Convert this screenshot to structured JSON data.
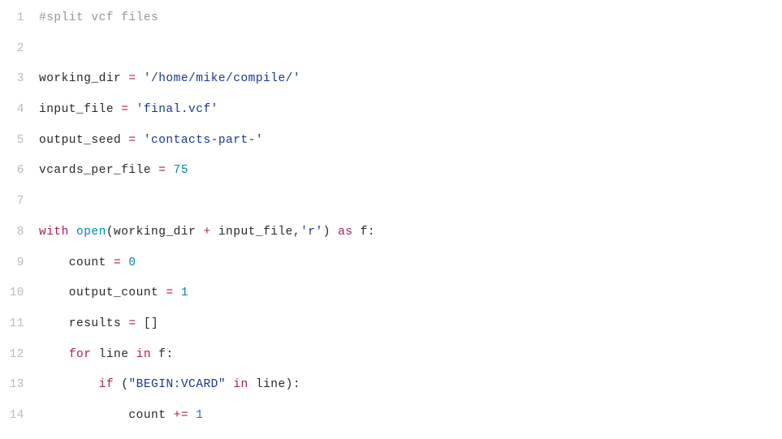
{
  "lines": [
    {
      "n": "1",
      "tokens": [
        {
          "cls": "tok-comment",
          "t": "#split vcf files"
        }
      ]
    },
    {
      "n": "2",
      "tokens": [
        {
          "cls": "tok-default",
          "t": ""
        }
      ]
    },
    {
      "n": "3",
      "tokens": [
        {
          "cls": "tok-default",
          "t": "working_dir "
        },
        {
          "cls": "tok-op",
          "t": "="
        },
        {
          "cls": "tok-default",
          "t": " "
        },
        {
          "cls": "tok-string",
          "t": "'/home/mike/compile/'"
        }
      ]
    },
    {
      "n": "4",
      "tokens": [
        {
          "cls": "tok-default",
          "t": "input_file "
        },
        {
          "cls": "tok-op",
          "t": "="
        },
        {
          "cls": "tok-default",
          "t": " "
        },
        {
          "cls": "tok-string",
          "t": "'final.vcf'"
        }
      ]
    },
    {
      "n": "5",
      "tokens": [
        {
          "cls": "tok-default",
          "t": "output_seed "
        },
        {
          "cls": "tok-op",
          "t": "="
        },
        {
          "cls": "tok-default",
          "t": " "
        },
        {
          "cls": "tok-string",
          "t": "'contacts-part-'"
        }
      ]
    },
    {
      "n": "6",
      "tokens": [
        {
          "cls": "tok-default",
          "t": "vcards_per_file "
        },
        {
          "cls": "tok-op",
          "t": "="
        },
        {
          "cls": "tok-default",
          "t": " "
        },
        {
          "cls": "tok-number",
          "t": "75"
        }
      ]
    },
    {
      "n": "7",
      "tokens": [
        {
          "cls": "tok-default",
          "t": ""
        }
      ]
    },
    {
      "n": "8",
      "tokens": [
        {
          "cls": "tok-keyword",
          "t": "with"
        },
        {
          "cls": "tok-default",
          "t": " "
        },
        {
          "cls": "tok-builtin",
          "t": "open"
        },
        {
          "cls": "tok-default",
          "t": "(working_dir "
        },
        {
          "cls": "tok-op",
          "t": "+"
        },
        {
          "cls": "tok-default",
          "t": " input_file,"
        },
        {
          "cls": "tok-string",
          "t": "'r'"
        },
        {
          "cls": "tok-default",
          "t": ") "
        },
        {
          "cls": "tok-keyword",
          "t": "as"
        },
        {
          "cls": "tok-default",
          "t": " f:"
        }
      ]
    },
    {
      "n": "9",
      "tokens": [
        {
          "cls": "tok-default",
          "t": "    count "
        },
        {
          "cls": "tok-op",
          "t": "="
        },
        {
          "cls": "tok-default",
          "t": " "
        },
        {
          "cls": "tok-number",
          "t": "0"
        }
      ]
    },
    {
      "n": "10",
      "tokens": [
        {
          "cls": "tok-default",
          "t": "    output_count "
        },
        {
          "cls": "tok-op",
          "t": "="
        },
        {
          "cls": "tok-default",
          "t": " "
        },
        {
          "cls": "tok-number",
          "t": "1"
        }
      ]
    },
    {
      "n": "11",
      "tokens": [
        {
          "cls": "tok-default",
          "t": "    results "
        },
        {
          "cls": "tok-op",
          "t": "="
        },
        {
          "cls": "tok-default",
          "t": " []"
        }
      ]
    },
    {
      "n": "12",
      "tokens": [
        {
          "cls": "tok-default",
          "t": "    "
        },
        {
          "cls": "tok-keyword",
          "t": "for"
        },
        {
          "cls": "tok-default",
          "t": " line "
        },
        {
          "cls": "tok-keyword",
          "t": "in"
        },
        {
          "cls": "tok-default",
          "t": " f:"
        }
      ]
    },
    {
      "n": "13",
      "tokens": [
        {
          "cls": "tok-default",
          "t": "        "
        },
        {
          "cls": "tok-keyword",
          "t": "if"
        },
        {
          "cls": "tok-default",
          "t": " ("
        },
        {
          "cls": "tok-string",
          "t": "\"BEGIN:VCARD\""
        },
        {
          "cls": "tok-default",
          "t": " "
        },
        {
          "cls": "tok-keyword",
          "t": "in"
        },
        {
          "cls": "tok-default",
          "t": " line):"
        }
      ]
    },
    {
      "n": "14",
      "tokens": [
        {
          "cls": "tok-default",
          "t": "            count "
        },
        {
          "cls": "tok-op",
          "t": "+="
        },
        {
          "cls": "tok-default",
          "t": " "
        },
        {
          "cls": "tok-number",
          "t": "1"
        }
      ]
    }
  ]
}
